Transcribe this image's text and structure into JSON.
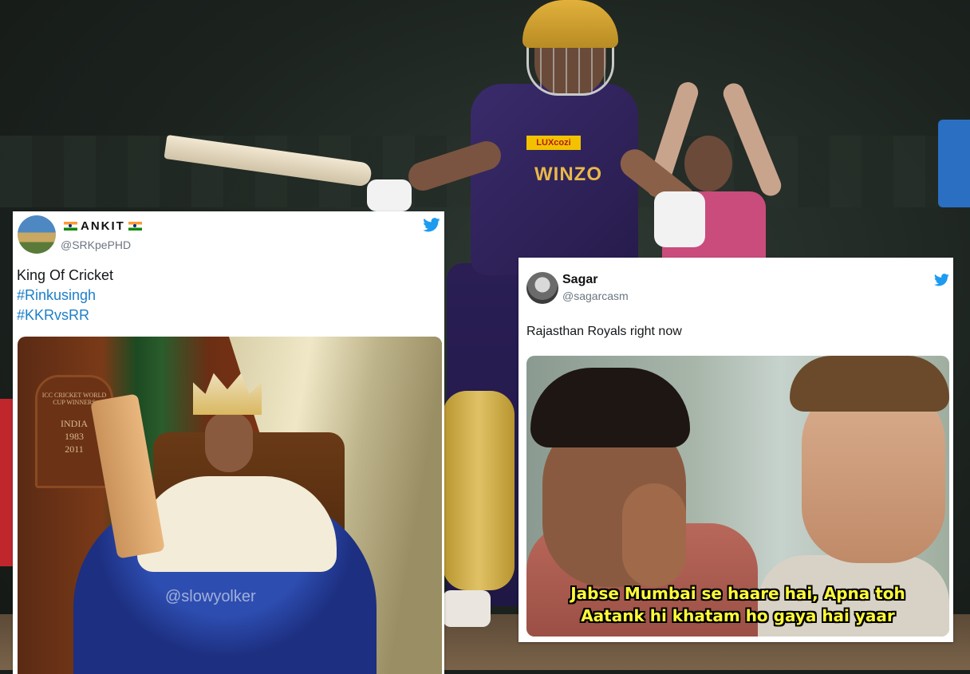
{
  "tweet1": {
    "display_name": "ANKIT",
    "handle": "@SRKpePHD",
    "text": "King Of Cricket",
    "hashtags": [
      "#Rinkusingh",
      "#KKRvsRR"
    ],
    "media": {
      "plaque_title": "ICC CRICKET WORLD CUP WINNERS",
      "plaque_country": "INDIA",
      "plaque_year1": "1983",
      "plaque_year2": "2011",
      "watermark": "@slowyolker"
    }
  },
  "tweet2": {
    "display_name": "Sagar",
    "handle": "@sagarcasm",
    "text": "Rajasthan Royals right now",
    "media": {
      "caption_line1": "Jabse Mumbai se haare hai, Apna toh",
      "caption_line2": "Aatank hi khatam ho gaya hai yaar"
    }
  },
  "background": {
    "jersey_sponsor1": "LUXcozi",
    "jersey_sponsor2": "WINZO"
  },
  "icons": {
    "brand": "twitter-bird-icon",
    "flag": "india-flag-icon"
  },
  "colors": {
    "twitter_blue": "#1d9bf0",
    "hashtag_blue": "#1d7fc8",
    "caption_yellow": "#fffb38"
  }
}
